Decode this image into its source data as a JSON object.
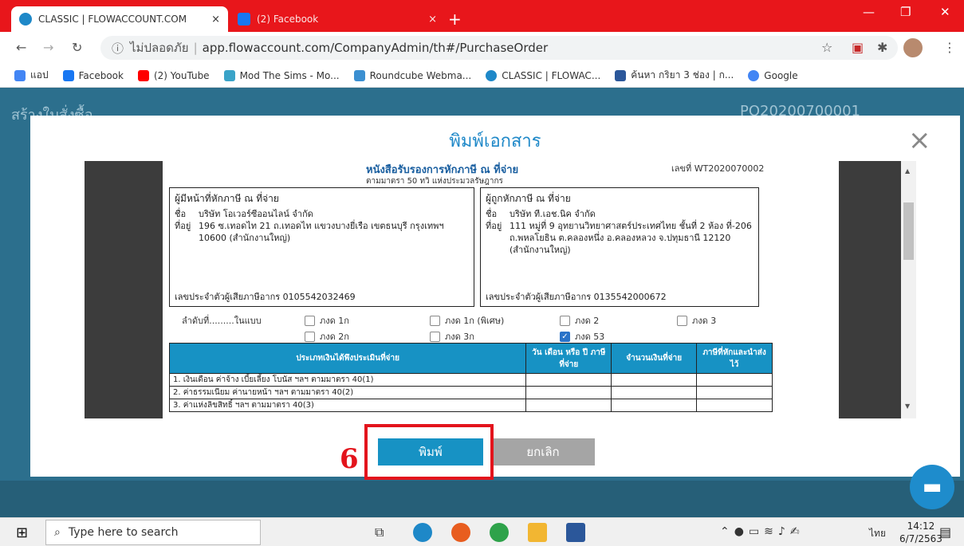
{
  "browser": {
    "tabs": [
      {
        "title": "CLASSIC | FLOWACCOUNT.COM",
        "close": "×"
      },
      {
        "title": "(2) Facebook",
        "close": "×"
      }
    ],
    "new_tab": "+",
    "window_controls": [
      "—",
      "❐",
      "✕"
    ],
    "address": {
      "security": "ไม่ปลอดภัย",
      "url": "app.flowaccount.com/CompanyAdmin/th#/PurchaseOrder"
    },
    "bookmarks": [
      {
        "label": "แอป",
        "icon": "apps-icon",
        "color": "#4285f4"
      },
      {
        "label": "Facebook",
        "icon": "facebook-icon",
        "color": "#1877f2"
      },
      {
        "label": "(2) YouTube",
        "icon": "youtube-icon",
        "color": "#ff0000"
      },
      {
        "label": "Mod The Sims - Mo...",
        "icon": "modthesims-icon",
        "color": "#3aa3c8"
      },
      {
        "label": "Roundcube Webma...",
        "icon": "roundcube-icon",
        "color": "#3b8fd1"
      },
      {
        "label": "CLASSIC | FLOWAC...",
        "icon": "flowaccount-icon",
        "color": "#1e88c8"
      },
      {
        "label": "ค้นหา กริยา 3 ช่อง | ก...",
        "icon": "word-icon",
        "color": "#2b579a"
      },
      {
        "label": "Google",
        "icon": "google-icon",
        "color": "#4285f4"
      }
    ]
  },
  "background": {
    "heading": "สร้างใบสั่งซื้อ",
    "doc_number": "PO20200700001"
  },
  "modal": {
    "title": "พิมพ์เอกสาร",
    "close": "×",
    "print_label": "พิมพ์",
    "cancel_label": "ยกเลิก"
  },
  "document": {
    "title": "หนังสือรับรองการหักภาษี ณ ที่จ่าย",
    "subtitle": "ตามมาตรา 50 ทวิ แห่งประมวลรัษฎากร",
    "doc_no": "เลขที่ WT2020070002",
    "payer": {
      "heading": "ผู้มีหน้าที่หักภาษี ณ ที่จ่าย",
      "name_label": "ชื่อ",
      "name": "บริษัท โอเวอร์ซีออนไลน์ จำกัด",
      "addr_label": "ที่อยู่",
      "address": "196 ซ.เทอดไท 21 ถ.เทอดไท แขวงบางยี่เรือ เขตธนบุรี กรุงเทพฯ 10600 (สำนักงานใหญ่)",
      "tax_id": "เลขประจำตัวผู้เสียภาษีอากร 0105542032469"
    },
    "payee": {
      "heading": "ผู้ถูกหักภาษี ณ ที่จ่าย",
      "name_label": "ชื่อ",
      "name": "บริษัท ที.เอช.นิค จำกัด",
      "addr_label": "ที่อยู่",
      "address": "111 หมู่ที่ 9 อุทยานวิทยาศาสตร์ประเทศไทย ชั้นที่ 2 ห้อง ที่-206 ถ.พหลโยธิน ต.คลองหนึ่ง อ.คลองหลวง จ.ปทุมธานี 12120 (สำนักงานใหญ่)",
      "tax_id": "เลขประจำตัวผู้เสียภาษีอากร 0135542000672"
    },
    "sequence_label": "ลำดับที่.........ในแบบ",
    "forms": [
      {
        "label": "ภงด 1ก",
        "checked": false
      },
      {
        "label": "ภงด 1ก (พิเศษ)",
        "checked": false
      },
      {
        "label": "ภงด 2",
        "checked": false
      },
      {
        "label": "ภงด 3",
        "checked": false
      },
      {
        "label": "ภงด 2ก",
        "checked": false
      },
      {
        "label": "ภงด 3ก",
        "checked": false
      },
      {
        "label": "ภงด 53",
        "checked": true
      }
    ],
    "table": {
      "headers": [
        "ประเภทเงินได้พึงประเมินที่จ่าย",
        "วัน เดือน หรือ ปี ภาษีที่จ่าย",
        "จำนวนเงินที่จ่าย",
        "ภาษีที่หักและนำส่งไว้"
      ],
      "rows": [
        "1. เงินเดือน ค่าจ้าง เบี้ยเลี้ยง โบนัส ฯลฯ ตามมาตรา 40(1)",
        "2. ค่าธรรมเนียม ค่านายหน้า ฯลฯ ตามมาตรา 40(2)",
        "3. ค่าแห่งลิขสิทธิ์ ฯลฯ ตามมาตรา 40(3)"
      ]
    }
  },
  "annotation": {
    "step": "6"
  },
  "taskbar": {
    "search_placeholder": "Type here to search",
    "lang": "ไทย",
    "time": "14:12",
    "date": "6/7/2563"
  }
}
